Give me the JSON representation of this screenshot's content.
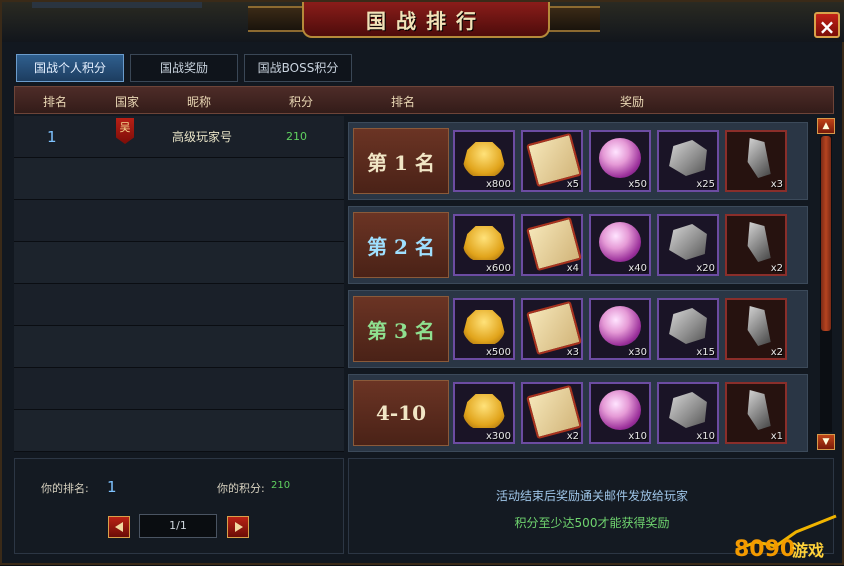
{
  "title": "国战排行",
  "close_label": "×",
  "tabs": [
    {
      "label": "国战个人积分",
      "active": true
    },
    {
      "label": "国战奖励",
      "active": false
    },
    {
      "label": "国战BOSS积分",
      "active": false
    }
  ],
  "headers": {
    "rank": "排名",
    "nation": "国家",
    "nickname": "昵称",
    "score": "积分",
    "reward_rank": "排名",
    "reward": "奖励"
  },
  "players": [
    {
      "rank": "1",
      "nation": "吴",
      "nickname": "高级玩家号",
      "score": "210"
    }
  ],
  "empty_rows": 7,
  "rewards": [
    {
      "label": "第 1 名",
      "color": "#f1e6c6",
      "qty": [
        "x800",
        "x5",
        "x50",
        "x25",
        "x3"
      ]
    },
    {
      "label": "第 2 名",
      "color": "#9fe0ff",
      "qty": [
        "x600",
        "x4",
        "x40",
        "x20",
        "x2"
      ]
    },
    {
      "label": "第 3 名",
      "color": "#8fe08f",
      "qty": [
        "x500",
        "x3",
        "x30",
        "x15",
        "x2"
      ]
    },
    {
      "label": "4-10",
      "color": "#f1e6c6",
      "qty": [
        "x300",
        "x2",
        "x10",
        "x10",
        "x1"
      ]
    }
  ],
  "reward_item_icons": [
    "gold-ingot-icon",
    "scroll-icon",
    "pink-orb-icon",
    "stone-icon",
    "blade-shard-icon"
  ],
  "my_rank_label": "你的排名:",
  "my_rank": "1",
  "my_score_label": "你的积分:",
  "my_score": "210",
  "page": "1/1",
  "notice_line1": "活动结束后奖励通关邮件发放给玩家",
  "notice_line2": "积分至少达500才能获得奖励",
  "watermark": "8090游戏"
}
